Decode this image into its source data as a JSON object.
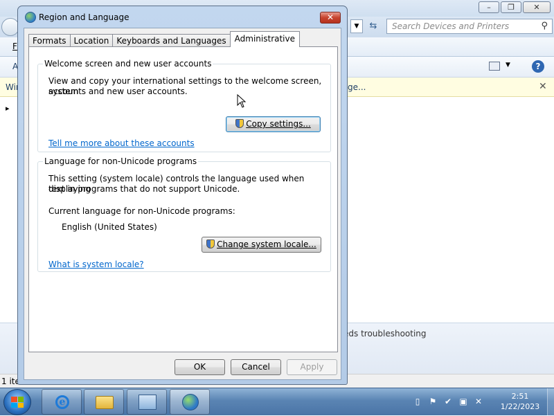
{
  "background_window": {
    "search_placeholder": "Search Devices and Printers",
    "menu_stub": "F",
    "toolbar_stub": "A",
    "infobar_left": "Win",
    "infobar_right": "ge...",
    "detail_text": "eds troubleshooting",
    "status_text": "1 ite",
    "controls": {
      "minimize": "–",
      "maximize": "❐",
      "close": "✕"
    }
  },
  "dialog": {
    "title": "Region and Language",
    "close_label": "✕",
    "tabs": [
      {
        "label": "Formats",
        "active": false
      },
      {
        "label": "Location",
        "active": false
      },
      {
        "label": "Keyboards and Languages",
        "active": false
      },
      {
        "label": "Administrative",
        "active": true
      }
    ],
    "welcome_group": {
      "title": "Welcome screen and new user accounts",
      "description_line1": "View and copy your international settings to the welcome screen, system",
      "description_line2": "accounts and new user accounts.",
      "copy_button": "Copy settings...",
      "link": "Tell me more about these accounts"
    },
    "unicode_group": {
      "title": "Language for non-Unicode programs",
      "description_line1": "This setting (system locale) controls the language used when displaying",
      "description_line2": "text in programs that do not support Unicode.",
      "current_label": "Current language for non-Unicode programs:",
      "current_value": "English (United States)",
      "change_button": "Change system locale...",
      "link": "What is system locale?"
    },
    "buttons": {
      "ok": "OK",
      "cancel": "Cancel",
      "apply": "Apply"
    }
  },
  "taskbar": {
    "pinned": [
      "internet-explorer",
      "windows-explorer",
      "control-panel",
      "region-and-language"
    ],
    "tray_icons": [
      "action-center",
      "flag",
      "security",
      "network",
      "volume-muted"
    ],
    "time": "2:51",
    "date": "1/22/2023"
  },
  "colors": {
    "link": "#0066cc",
    "taskbar": "#5a84b3",
    "close_button": "#c7442f"
  }
}
